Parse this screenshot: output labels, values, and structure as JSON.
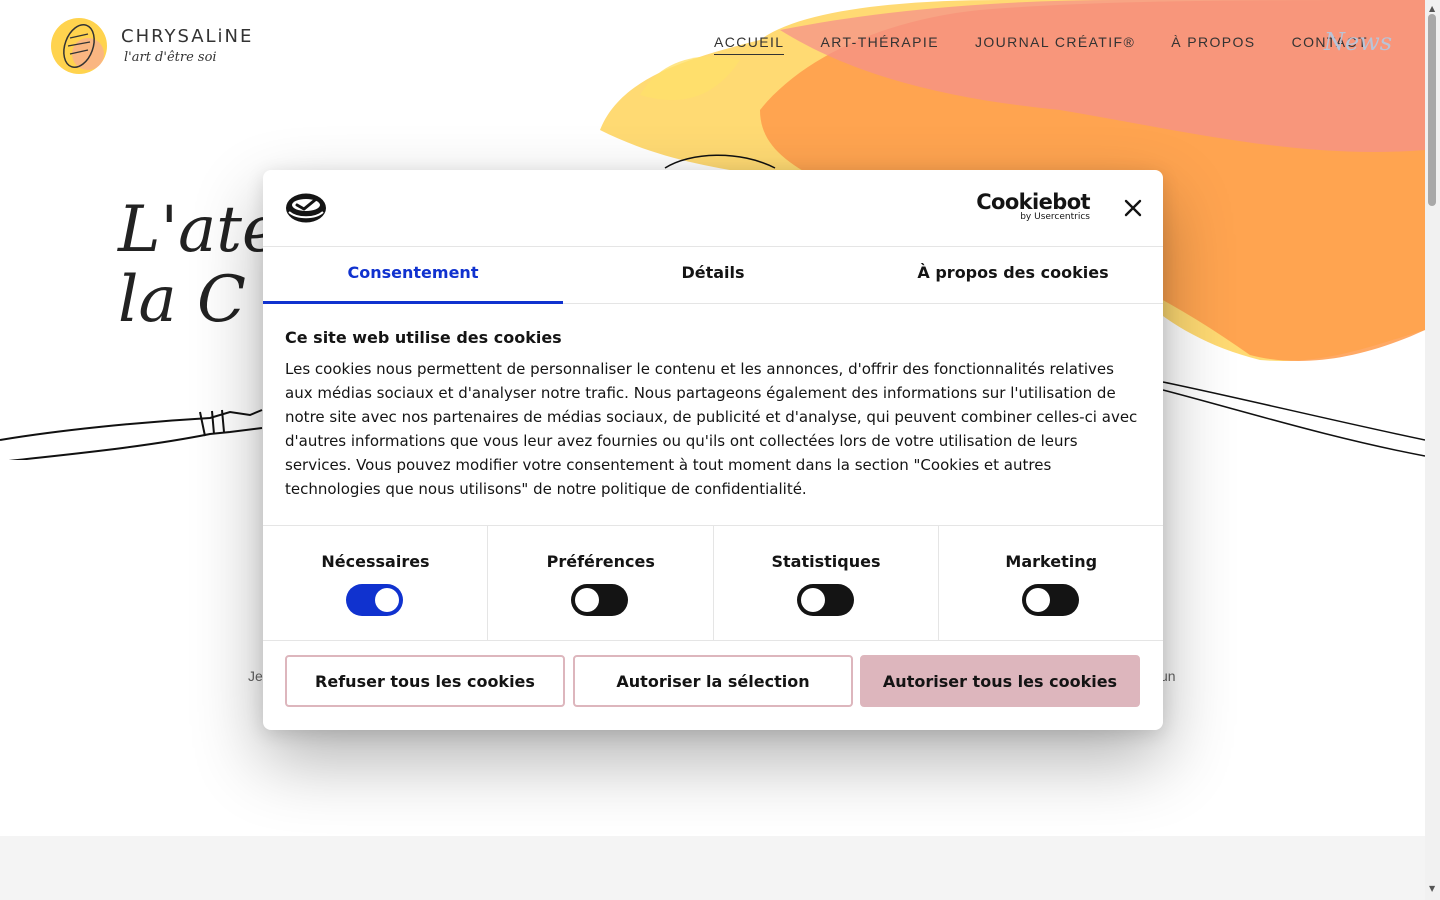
{
  "site": {
    "logo_name": "CHRYSALiNE",
    "logo_tagline": "l'art d'être soi",
    "nav": [
      {
        "label": "ACCUEIL",
        "active": true
      },
      {
        "label": "ART-THÉRAPIE",
        "active": false
      },
      {
        "label": "JOURNAL CRÉATIF®",
        "active": false
      },
      {
        "label": "À PROPOS",
        "active": false
      },
      {
        "label": "CONTACT",
        "active": false
      }
    ],
    "nav_script": "News",
    "hero_line1": "L'atelier",
    "hero_line2": "la C",
    "bg_text_left": "Je",
    "bg_text_right": "un"
  },
  "dialog": {
    "brand": "Cookiebot",
    "brand_sub": "by Usercentrics",
    "tabs": [
      {
        "label": "Consentement",
        "active": true
      },
      {
        "label": "Détails",
        "active": false
      },
      {
        "label": "À propos des cookies",
        "active": false
      }
    ],
    "title": "Ce site web utilise des cookies",
    "body": "Les cookies nous permettent de personnaliser le contenu et les annonces, d'offrir des fonctionnalités relatives aux médias sociaux et d'analyser notre trafic. Nous partageons également des informations sur l'utilisation de notre site avec nos partenaires de médias sociaux, de publicité et d'analyse, qui peuvent combiner celles-ci avec d'autres informations que vous leur avez fournies ou qu'ils ont collectées lors de votre utilisation de leurs services. Vous pouvez modifier votre consentement à tout moment dans la section \"Cookies et autres technologies que nous utilisons\" de notre politique de confidentialité.",
    "toggles": [
      {
        "label": "Nécessaires",
        "on": true
      },
      {
        "label": "Préférences",
        "on": false
      },
      {
        "label": "Statistiques",
        "on": false
      },
      {
        "label": "Marketing",
        "on": false
      }
    ],
    "buttons": {
      "deny": "Refuser tous les cookies",
      "selection": "Autoriser la sélection",
      "allow_all": "Autoriser tous les cookies"
    }
  },
  "colors": {
    "accent_blue": "#1032cf",
    "button_pink": "#ddb6bd",
    "toggle_off": "#141414"
  }
}
